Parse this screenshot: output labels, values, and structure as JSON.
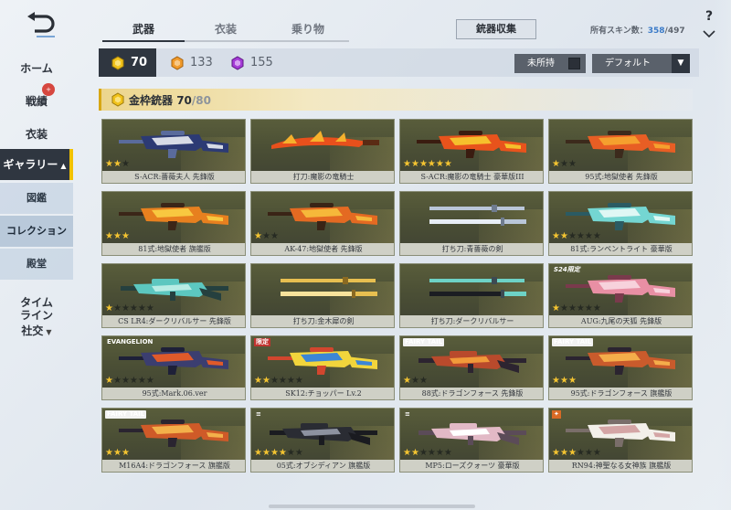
{
  "sidebar": {
    "back_icon": "back-arrow-icon",
    "items": {
      "home": "ホーム",
      "record": "戦績",
      "record_badge": "+",
      "costume": "衣装",
      "gallery": "ギャラリー",
      "gallery_chevron": "▲",
      "illustration": "図鑑",
      "collection": "コレクション",
      "hall": "殿堂",
      "timeline": "タイム\nライン",
      "social": "社交",
      "social_chevron": "▼"
    }
  },
  "tabs": [
    {
      "label": "武器",
      "active": true
    },
    {
      "label": "衣装",
      "active": false
    },
    {
      "label": "乗り物",
      "active": false
    }
  ],
  "collect_button": "銃器収集",
  "skin_count": {
    "label": "所有スキン数：",
    "owned": "358",
    "total": "/497"
  },
  "help_label": "?",
  "currencies": [
    {
      "icon": "gold-coin-icon",
      "value": "70",
      "active": true,
      "color": "#f1c21b"
    },
    {
      "icon": "orange-coin-icon",
      "value": "133",
      "active": false,
      "color": "#f09a2b"
    },
    {
      "icon": "purple-coin-icon",
      "value": "155",
      "active": false,
      "color": "#a43ad6"
    }
  ],
  "filter": {
    "unowned_label": "未所持",
    "sort_label": "デフォルト",
    "sort_arrow": "▼"
  },
  "section": {
    "title": "金枠銃器",
    "count": "70",
    "total": "/80"
  },
  "cards": [
    {
      "name": "S-ACR:薔薇夫人 先鋒版",
      "stars": 2,
      "max": 3,
      "tag": "",
      "tag_class": "",
      "colors": [
        "#2c3a74",
        "#d7dbe6",
        "#5a6b9c"
      ],
      "kind": "rifle"
    },
    {
      "name": "打刀:魔影の竜騎士",
      "stars": 0,
      "max": 0,
      "tag": "",
      "tag_class": "",
      "colors": [
        "#e8501c",
        "#f6b12c",
        "#5a2b14"
      ],
      "kind": "blade"
    },
    {
      "name": "S-ACR:魔影の竜騎士 豪華版III",
      "stars": 6,
      "max": 6,
      "tag": "",
      "tag_class": "",
      "colors": [
        "#e8531c",
        "#f6c02c",
        "#3a1c10"
      ],
      "kind": "rifle"
    },
    {
      "name": "95式:地獄使者 先鋒版",
      "stars": 1,
      "max": 3,
      "tag": "",
      "tag_class": "",
      "colors": [
        "#e85e24",
        "#f5a02e",
        "#3c2a1c"
      ],
      "kind": "rifle"
    },
    {
      "name": "81式:地獄使者 旗艦版",
      "stars": 3,
      "max": 3,
      "tag": "",
      "tag_class": "",
      "colors": [
        "#e7801f",
        "#f8c840",
        "#3b2618"
      ],
      "kind": "rifle"
    },
    {
      "name": "AK-47:地獄使者 先鋒版",
      "stars": 1,
      "max": 3,
      "tag": "",
      "tag_class": "",
      "colors": [
        "#e46a22",
        "#f6b83a",
        "#3a2416"
      ],
      "kind": "rifle"
    },
    {
      "name": "打ち刀:青薔薇の剣",
      "stars": 0,
      "max": 0,
      "tag": "",
      "tag_class": "",
      "colors": [
        "#b9c6d8",
        "#e8eef6",
        "#6f7c8f"
      ],
      "kind": "sword2"
    },
    {
      "name": "81式:ランペントライト 豪華版",
      "stars": 2,
      "max": 6,
      "tag": "",
      "tag_class": "",
      "colors": [
        "#74d6d2",
        "#dff7f4",
        "#2b5b63"
      ],
      "kind": "rifle"
    },
    {
      "name": "CS LR4:ダークリバルサー 先鋒版",
      "stars": 1,
      "max": 6,
      "tag": "",
      "tag_class": "",
      "colors": [
        "#5cc7c0",
        "#b8ece4",
        "#25403f"
      ],
      "kind": "sniper"
    },
    {
      "name": "打ち刀:金木犀の剣",
      "stars": 0,
      "max": 0,
      "tag": "",
      "tag_class": "",
      "colors": [
        "#e7bf50",
        "#f8e39c",
        "#8a6a22"
      ],
      "kind": "sword2"
    },
    {
      "name": "打ち刀:ダークリバルサー",
      "stars": 0,
      "max": 0,
      "tag": "",
      "tag_class": "",
      "colors": [
        "#6dd2c6",
        "#1b1d22",
        "#3d4a52"
      ],
      "kind": "sword2"
    },
    {
      "name": "AUG:九尾の天狐 先鋒版",
      "stars": 1,
      "max": 6,
      "tag": "S24限定",
      "tag_class": "tag-s24",
      "colors": [
        "#e88fa4",
        "#f7d2dc",
        "#7a3a4c"
      ],
      "kind": "rifle"
    },
    {
      "name": "95式:Mark.06.ver",
      "stars": 1,
      "max": 6,
      "tag": "EVANGELION",
      "tag_class": "tag-eva",
      "colors": [
        "#3b3e70",
        "#e05a2a",
        "#1e2038"
      ],
      "kind": "rifle"
    },
    {
      "name": "SK12:チョッパー Lv.2",
      "stars": 2,
      "max": 6,
      "tag": "限定",
      "tag_class": "tag-red",
      "colors": [
        "#f2d53c",
        "#3c86d6",
        "#d2462e"
      ],
      "kind": "rifle"
    },
    {
      "name": "88式:ドラゴンフォース 先鋒版",
      "stars": 1,
      "max": 3,
      "tag": "FAIRY TAIL",
      "tag_class": "tag-ft",
      "colors": [
        "#b94a2c",
        "#f19a3a",
        "#2c2430"
      ],
      "kind": "sniper"
    },
    {
      "name": "95式:ドラゴンフォース 旗艦版",
      "stars": 3,
      "max": 3,
      "tag": "FAIRY TAIL",
      "tag_class": "tag-ft",
      "colors": [
        "#c95b2c",
        "#f5ad4a",
        "#2b2430"
      ],
      "kind": "rifle"
    },
    {
      "name": "M16A4:ドラゴンフォース 旗艦版",
      "stars": 3,
      "max": 3,
      "tag": "FAIRY TAIL",
      "tag_class": "tag-ft",
      "colors": [
        "#cf5a28",
        "#f3b04a",
        "#2a2430"
      ],
      "kind": "rifle"
    },
    {
      "name": "05式:オブシディアン 旗艦版",
      "stars": 4,
      "max": 6,
      "tag": "≡",
      "tag_class": "tag-dash",
      "colors": [
        "#2a2c33",
        "#8d92a0",
        "#1a1b20"
      ],
      "kind": "sniper"
    },
    {
      "name": "MP5:ローズクォーツ 豪華版",
      "stars": 2,
      "max": 6,
      "tag": "≡",
      "tag_class": "tag-dash",
      "colors": [
        "#e2b9c6",
        "#ffffff",
        "#5b4b58"
      ],
      "kind": "sniper"
    },
    {
      "name": "RN94:神聖なる女神族 旗艦版",
      "stars": 3,
      "max": 6,
      "tag": "✦",
      "tag_class": "tag-flame",
      "colors": [
        "#f3f0ea",
        "#d4a5a5",
        "#7a6e6a"
      ],
      "kind": "rifle"
    }
  ]
}
